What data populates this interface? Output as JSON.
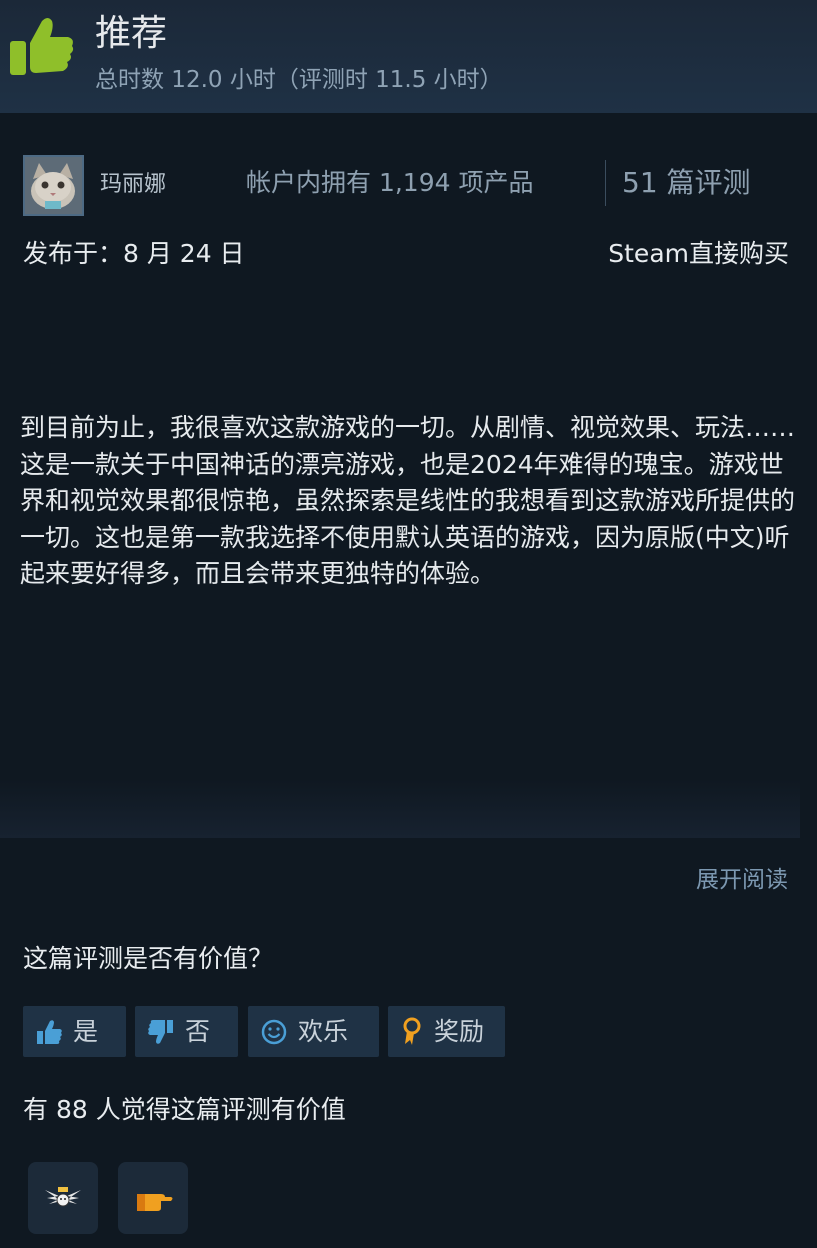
{
  "review": {
    "verdict": "推荐",
    "hours": "总时数 12.0 小时（评测时 11.5 小时）"
  },
  "author": {
    "name": "玛丽娜",
    "products_owned": "帐户内拥有 1,194 项产品",
    "review_count": "51 篇评测"
  },
  "meta": {
    "posted": "发布于：8 月 24 日",
    "purchase_type": "Steam直接购买"
  },
  "body": "到目前为止，我很喜欢这款游戏的一切。从剧情、视觉效果、玩法……这是一款关于中国神话的漂亮游戏，也是2024年难得的瑰宝。游戏世界和视觉效果都很惊艳，虽然探索是线性的我想看到这款游戏所提供的一切。这也是第一款我选择不使用默认英语的游戏，因为原版(中文)听起来要好得多，而且会带来更独特的体验。",
  "expand_label": "展开阅读",
  "feedback": {
    "question": "这篇评测是否有价值？",
    "buttons": [
      {
        "label": "是",
        "icon": "thumbs-up-icon"
      },
      {
        "label": "否",
        "icon": "thumbs-down-icon"
      },
      {
        "label": "欢乐",
        "icon": "smiley-icon"
      },
      {
        "label": "奖励",
        "icon": "award-ribbon-icon"
      }
    ],
    "helpful_count_text": "有 88 人觉得这篇评测有价值"
  },
  "awards": [
    {
      "icon": "winged-award-icon"
    },
    {
      "icon": "pointing-hand-award-icon"
    }
  ],
  "colors": {
    "background": "#0f1821",
    "header": "#1b2838",
    "recommend_green": "#8fbf2a",
    "thumb_blue": "#4a9fd6",
    "award_orange": "#f0a020"
  }
}
